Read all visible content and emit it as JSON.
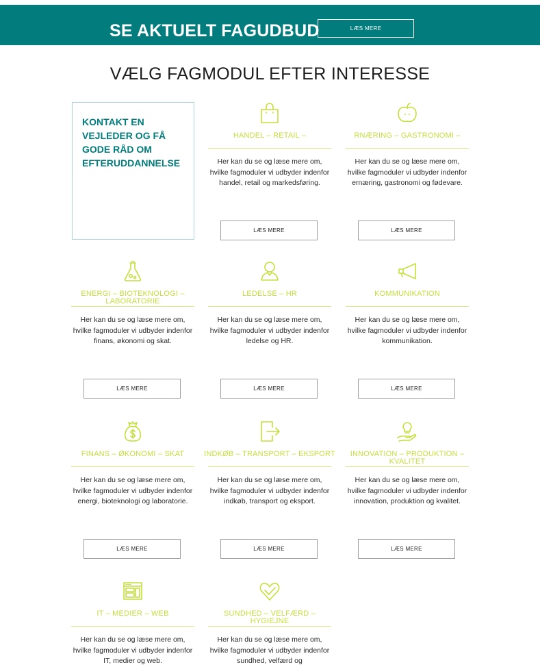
{
  "banner": {
    "title": "SE AKTUELT FAGUDBUD",
    "button_label": "LÆS MERE"
  },
  "section_title": "VÆLG FAGMODUL EFTER INTERESSE",
  "contact_box": {
    "text": "KONTAKT EN VEJLEDER OG FÅ GODE RÅD OM EFTERUDDANNELSE"
  },
  "colors": {
    "teal": "#027c7d",
    "lime": "#c3df3a"
  },
  "cards": [
    {
      "icon": "shopping-bag-icon",
      "title": "HANDEL – RETAIL –",
      "description": "Her kan du se og læse mere om, hvilke fagmoduler vi udbyder indenfor handel, retail og markedsføring.",
      "button": "LÆS MERE"
    },
    {
      "icon": "apple-icon",
      "title": "RNÆRING – GASTRONOMI –",
      "description": "Her kan du se og læse mere om, hvilke fagmoduler vi udbyder indenfor ernæring, gastronomi og fødevare.",
      "button": "LÆS MERE"
    },
    {
      "icon": "flask-icon",
      "title": "ENERGI – BIOTEKNOLOGI – LABORATORIE",
      "description": "Her kan du se og læse mere om, hvilke fagmoduler vi udbyder indenfor finans, økonomi og skat.",
      "button": "LÆS MERE"
    },
    {
      "icon": "person-icon",
      "title": "LEDELSE – HR",
      "description": "Her kan du se og læse mere om, hvilke fagmoduler vi udbyder indenfor ledelse og HR.",
      "button": "LÆS MERE"
    },
    {
      "icon": "megaphone-icon",
      "title": "KOMMUNIKATION",
      "description": "Her kan du se og læse mere om, hvilke fagmoduler vi udbyder indenfor kommunikation.",
      "button": "LÆS MERE"
    },
    {
      "icon": "money-bag-icon",
      "title": "FINANS – ØKONOMI – SKAT",
      "description": "Her kan du se og læse mere om, hvilke fagmoduler vi udbyder indenfor energi, bioteknologi og laboratorie.",
      "button": "LÆS MERE"
    },
    {
      "icon": "export-icon",
      "title": "INDKØB – TRANSPORT – EKSPORT",
      "description": "Her kan du se og læse mere om, hvilke fagmoduler vi udbyder indenfor indkøb, transport og eksport.",
      "button": "LÆS MERE"
    },
    {
      "icon": "lightbulb-hand-icon",
      "title": "INNOVATION – PRODUKTION – KVALITET",
      "description": "Her kan du se og læse mere om, hvilke fagmoduler vi udbyder indenfor innovation, produktion og kvalitet.",
      "button": "LÆS MERE"
    },
    {
      "icon": "browser-icon",
      "title": "IT – MEDIER – WEB",
      "description": "Her kan du se og læse mere om, hvilke fagmoduler vi udbyder indenfor IT, medier og web."
    },
    {
      "icon": "heart-check-icon",
      "title": "SUNDHED – VELFÆRD – HYGIEJNE",
      "description": "Her kan du se og læse mere om, hvilke fagmoduler vi udbyder indenfor sundhed, velfærd og"
    }
  ]
}
